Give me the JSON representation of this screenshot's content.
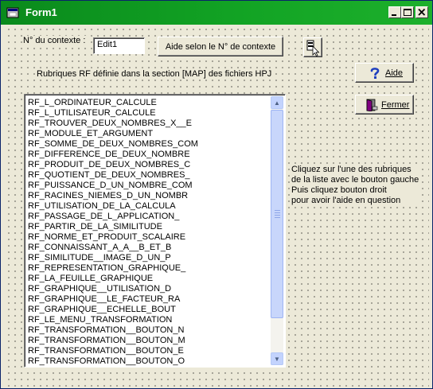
{
  "window": {
    "title": "Form1"
  },
  "labels": {
    "context": "N° du contexte :",
    "rubriques": "Rubriques RF définie dans la section [MAP] des fichiers  HPJ"
  },
  "edit": {
    "value": "Edit1"
  },
  "buttons": {
    "aide_contexte": "Aide selon le N° de contexte",
    "aide": "Aide",
    "fermer": "Fermer"
  },
  "list": {
    "items": [
      "RF_L_ORDINATEUR_CALCULE",
      "RF_L_UTILISATEUR_CALCULE",
      "RF_TROUVER_DEUX_NOMBRES_X__E",
      "RF_MODULE_ET_ARGUMENT",
      "RF_SOMME_DE_DEUX_NOMBRES_COM",
      "RF_DIFFERENCE_DE_DEUX_NOMBRE",
      "RF_PRODUIT_DE_DEUX_NOMBRES_C",
      "RF_QUOTIENT_DE_DEUX_NOMBRES_",
      "RF_PUISSANCE_D_UN_NOMBRE_COM",
      "RF_RACINES_NIEMES_D_UN_NOMBR",
      "RF_UTILISATION_DE_LA_CALCULA",
      "RF_PASSAGE_DE_L_APPLICATION_",
      "RF_PARTIR_DE_LA_SIMILITUDE",
      "RF_NORME_ET_PRODUIT_SCALAIRE",
      "RF_CONNAISSANT_A_A__B_ET_B",
      "RF_SIMILITUDE__IMAGE_D_UN_P",
      "RF_REPRESENTATION_GRAPHIQUE_",
      "RF_LA_FEUILLE_GRAPHIQUE",
      "RF_GRAPHIQUE__UTILISATION_D",
      "RF_GRAPHIQUE__LE_FACTEUR_RA",
      "RF_GRAPHIQUE__ECHELLE_BOUT",
      "RF_LE_MENU_TRANSFORMATION",
      "RF_TRANSFORMATION__BOUTON_N",
      "RF_TRANSFORMATION__BOUTON_M",
      "RF_TRANSFORMATION__BOUTON_E",
      "RF_TRANSFORMATION__BOUTON_O"
    ]
  },
  "help_text": [
    "Cliquez sur l'une des rubriques",
    "de la liste avec le bouton gauche",
    "Puis cliquez bouton droit",
    "pour avoir l'aide en question"
  ],
  "colors": {
    "titlebar": "#12a324",
    "face": "#ece9d8",
    "scrollbar": "#c3d3fd"
  },
  "icons": {
    "app": "form-icon",
    "context_help": "context-help-pointer-icon",
    "aide": "question-mark-icon",
    "fermer": "exit-door-icon"
  }
}
